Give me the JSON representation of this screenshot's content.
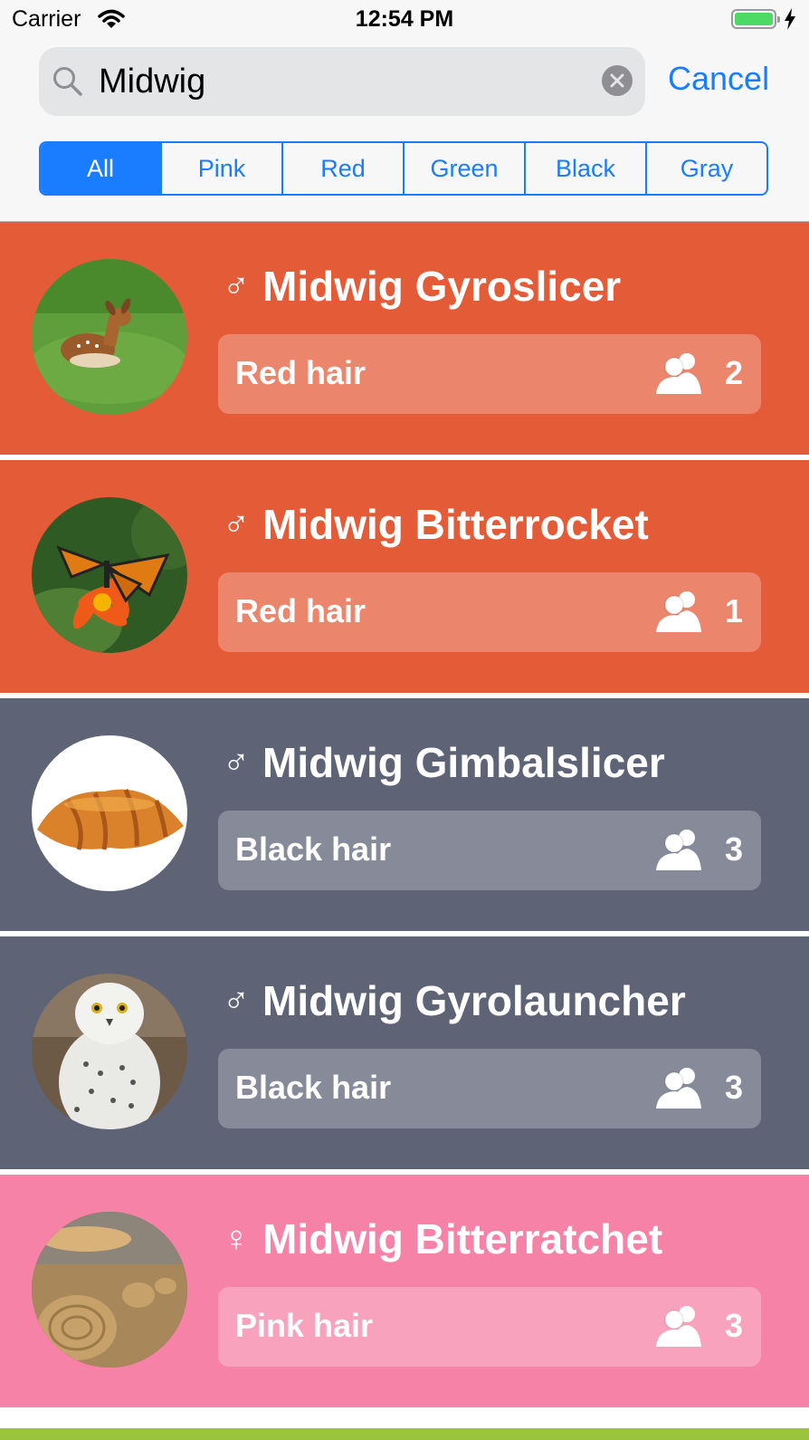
{
  "status_bar": {
    "carrier": "Carrier",
    "time": "12:54 PM",
    "battery_level": 1.0
  },
  "search": {
    "value": "Midwig",
    "cancel_label": "Cancel"
  },
  "segments": [
    {
      "label": "All",
      "active": true
    },
    {
      "label": "Pink",
      "active": false
    },
    {
      "label": "Red",
      "active": false
    },
    {
      "label": "Green",
      "active": false
    },
    {
      "label": "Black",
      "active": false
    },
    {
      "label": "Gray",
      "active": false
    }
  ],
  "results": [
    {
      "gender_symbol": "♂",
      "name": "Midwig Gyroslicer",
      "hair": "Red hair",
      "count": "2",
      "color": "#e45b38",
      "avatar": "fawn"
    },
    {
      "gender_symbol": "♂",
      "name": "Midwig Bitterrocket",
      "hair": "Red hair",
      "count": "1",
      "color": "#e45b38",
      "avatar": "butterfly"
    },
    {
      "gender_symbol": "♂",
      "name": "Midwig Gimbalslicer",
      "hair": "Black hair",
      "count": "3",
      "color": "#5e6376",
      "avatar": "croissant"
    },
    {
      "gender_symbol": "♂",
      "name": "Midwig Gyrolauncher",
      "hair": "Black hair",
      "count": "3",
      "color": "#5e6376",
      "avatar": "owl"
    },
    {
      "gender_symbol": "♀",
      "name": "Midwig Bitterratchet",
      "hair": "Pink hair",
      "count": "3",
      "color": "#f682a8",
      "avatar": "hay-bales"
    }
  ],
  "colors": {
    "accent": "#1a7cff",
    "red": "#e45b38",
    "black": "#5e6376",
    "pink": "#f682a8",
    "green": "#9ac43e"
  }
}
